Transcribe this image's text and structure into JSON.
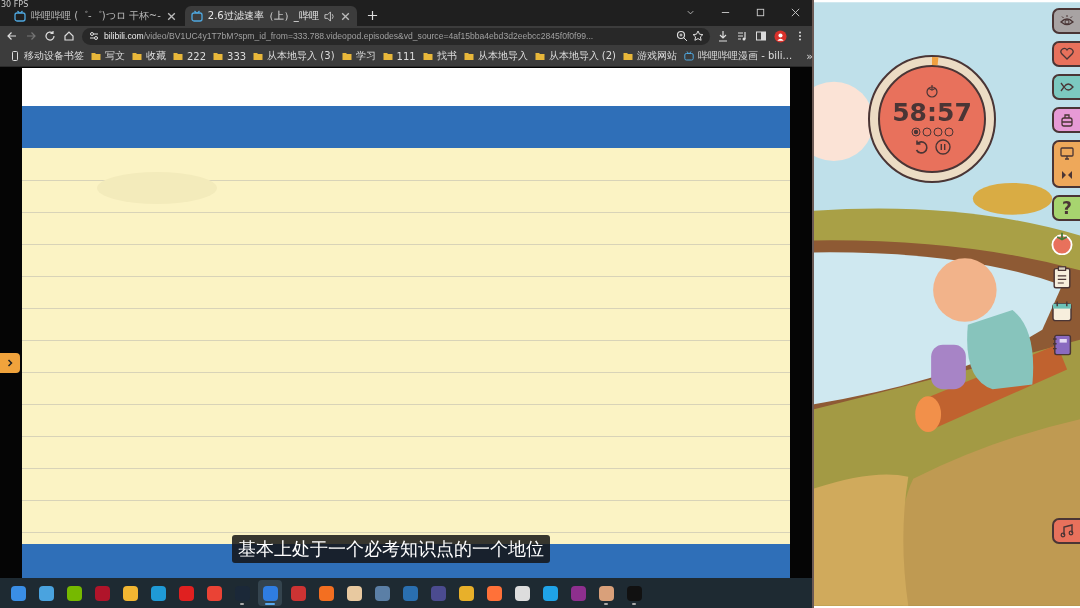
{
  "fps": "30 FPS",
  "tabs": [
    {
      "title": "哔哩哔哩 (゜-゜)つロ 干杯~-",
      "selected": false,
      "audio": false
    },
    {
      "title": "2.6过滤速率（上）_哔哩",
      "selected": true,
      "audio": true
    }
  ],
  "address": {
    "host": "bilibili.com",
    "path": "/video/BV1UC4y1T7bM?spm_id_from=333.788.videopod.episodes&vd_source=4af15bba4ebd3d2eebcc2845f0f0f99..."
  },
  "bookmarks": [
    {
      "label": "移动设备书签",
      "kind": "device"
    },
    {
      "label": "写文",
      "kind": "folder"
    },
    {
      "label": "收藏",
      "kind": "folder"
    },
    {
      "label": "222",
      "kind": "folder"
    },
    {
      "label": "333",
      "kind": "folder"
    },
    {
      "label": "从本地导入 (3)",
      "kind": "folder"
    },
    {
      "label": "学习",
      "kind": "folder"
    },
    {
      "label": "111",
      "kind": "folder"
    },
    {
      "label": "找书",
      "kind": "folder"
    },
    {
      "label": "从本地导入",
      "kind": "folder"
    },
    {
      "label": "从本地导入 (2)",
      "kind": "folder"
    },
    {
      "label": "游戏网站",
      "kind": "folder"
    },
    {
      "label": "哔哩哔哩漫画 - bili...",
      "kind": "site"
    }
  ],
  "bookmarks_more": "»",
  "video": {
    "kind": "picture",
    "subtitle": "基本上处于一个必考知识点的一个地位"
  },
  "taskbar": [
    {
      "running": false,
      "active": false
    },
    {
      "running": false,
      "active": false
    },
    {
      "running": false,
      "active": false
    },
    {
      "running": false,
      "active": false
    },
    {
      "running": false,
      "active": false
    },
    {
      "running": false,
      "active": false
    },
    {
      "running": false,
      "active": false
    },
    {
      "running": false,
      "active": false
    },
    {
      "running": true,
      "active": false
    },
    {
      "running": true,
      "active": true
    },
    {
      "running": false,
      "active": false
    },
    {
      "running": false,
      "active": false
    },
    {
      "running": false,
      "active": false
    },
    {
      "running": false,
      "active": false
    },
    {
      "running": false,
      "active": false
    },
    {
      "running": false,
      "active": false
    },
    {
      "running": false,
      "active": false
    },
    {
      "running": false,
      "active": false
    },
    {
      "running": false,
      "active": false
    },
    {
      "running": false,
      "active": false
    },
    {
      "running": false,
      "active": false
    },
    {
      "running": true,
      "active": false
    },
    {
      "running": true,
      "active": false
    }
  ],
  "timer": {
    "time": "58:57",
    "sessions": [
      {
        "done": true
      },
      {
        "done": false
      },
      {
        "done": false
      },
      {
        "done": false
      }
    ]
  },
  "help_label": "?"
}
